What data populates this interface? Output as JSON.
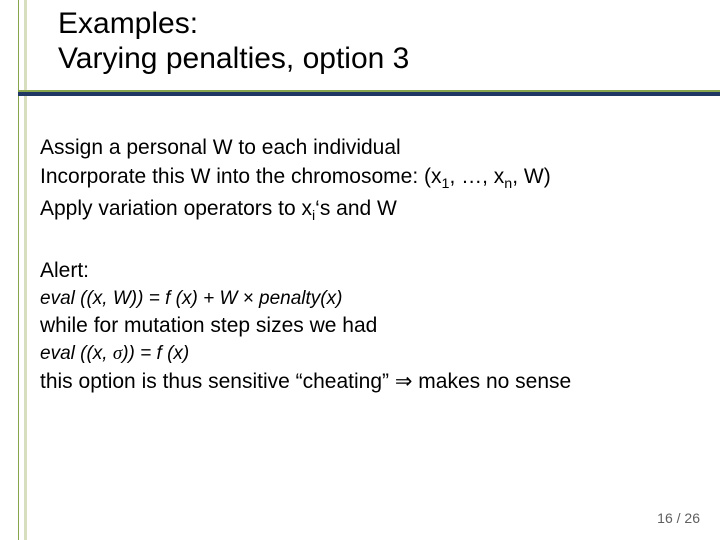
{
  "title": {
    "line1": "Examples:",
    "line2": "Varying penalties, option 3"
  },
  "body": {
    "items": [
      "Assign a personal W to each individual",
      "Incorporate this W into the chromosome: (x₁, …, xₙ, W)",
      "Apply variation operators to xᵢ's and W"
    ],
    "alert_label": "Alert:",
    "eq1": "eval ((x, W)) = f (x) + W × penalty(x)",
    "while_text": "while for mutation step sizes we had",
    "eq2": "eval ((x, σ)) = f (x)",
    "conclusion": "this option is thus sensitive \"cheating\" ⇒ makes no sense"
  },
  "footer": {
    "page": "16 / 26"
  }
}
